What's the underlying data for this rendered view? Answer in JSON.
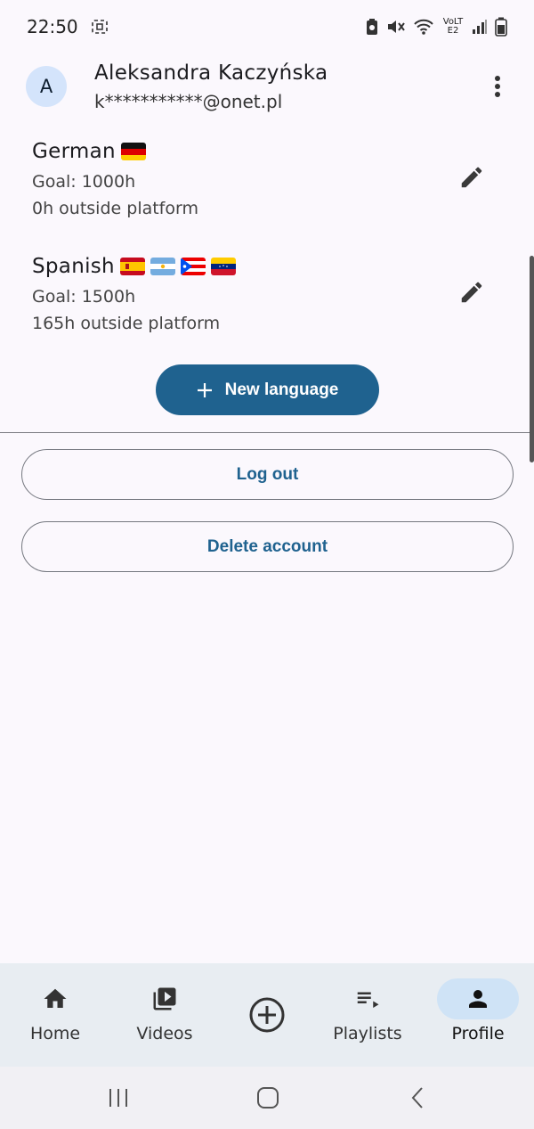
{
  "status": {
    "time": "22:50",
    "network_label": "VoLTE2"
  },
  "header": {
    "avatar_initial": "A",
    "name": "Aleksandra Kaczyńska",
    "email": "k***********@onet.pl"
  },
  "languages": [
    {
      "name": "German",
      "flags": [
        "de"
      ],
      "goal": "Goal: 1000h",
      "outside": "0h outside platform"
    },
    {
      "name": "Spanish",
      "flags": [
        "es",
        "ar",
        "pr",
        "ve"
      ],
      "goal": "Goal: 1500h",
      "outside": "165h outside platform"
    }
  ],
  "actions": {
    "new_language": "New language",
    "log_out": "Log out",
    "delete_account": "Delete account"
  },
  "bottom_nav": {
    "items": [
      {
        "label": "Home",
        "icon": "home-icon"
      },
      {
        "label": "Videos",
        "icon": "video-library-icon"
      },
      {
        "label": "",
        "icon": "add-circle-icon"
      },
      {
        "label": "Playlists",
        "icon": "playlist-play-icon"
      },
      {
        "label": "Profile",
        "icon": "person-icon",
        "active": true
      }
    ]
  },
  "colors": {
    "primary": "#1f628f",
    "background": "#fbf8fd",
    "nav_background": "#e8edf2",
    "active_indicator": "#cfe3f6",
    "avatar_bg": "#d4e4fb"
  }
}
